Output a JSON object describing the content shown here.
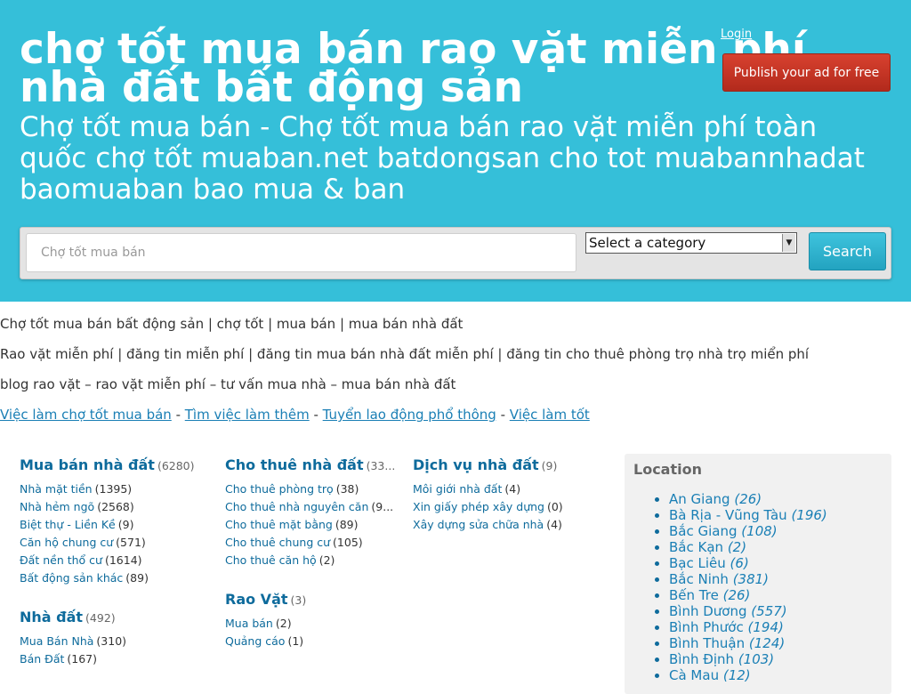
{
  "header": {
    "title": "chợ tốt mua bán rao vặt miễn phí nhà đất bất động sản",
    "description": "Chợ tốt mua bán - Chợ tốt mua bán rao vặt miễn phí toàn quốc chợ tốt muaban.net batdongsan cho tot muabannhadat baomuaban bao mua & ban",
    "login_label": "Login",
    "publish_label": "Publish your ad for free",
    "bg_color": "#35bfd9"
  },
  "search": {
    "placeholder": "Chợ tốt mua bán",
    "category_selected": "Select a category",
    "button_label": "Search"
  },
  "intro": {
    "line1": "Chợ tốt mua bán bất động sản | chợ tốt | mua bán | mua bán nhà đất",
    "line2": "Rao vặt miễn phí | đăng tin miễn phí | đăng tin mua bán nhà đất miễn phí | đăng tin cho thuê phòng trọ nhà trọ miển phí",
    "line3": "blog rao vặt – rao vặt miễn phí – tư vấn mua nhà – mua bán nhà đất",
    "links": [
      "Việc làm chợ tốt mua bán",
      "Tìm việc làm thêm",
      "Tuyển lao động phổ thông",
      "Việc làm tốt"
    ],
    "separator": " - "
  },
  "categories": {
    "mua_ban": {
      "title": "Mua bán nhà đất",
      "count": "(6280)",
      "items": [
        {
          "label": "Nhà mặt tiền",
          "count": "(1395)"
        },
        {
          "label": "Nhà hẻm ngõ",
          "count": "(2568)"
        },
        {
          "label": "Biệt thự - Liền Kề",
          "count": "(9)"
        },
        {
          "label": "Căn hộ chung cư",
          "count": "(571)"
        },
        {
          "label": "Đất nền thổ cư",
          "count": "(1614)"
        },
        {
          "label": "Bất động sản khác",
          "count": "(89)"
        }
      ]
    },
    "nha_dat": {
      "title": "Nhà đất",
      "count": "(492)",
      "items": [
        {
          "label": "Mua Bán Nhà",
          "count": "(310)"
        },
        {
          "label": "Bán Đất",
          "count": "(167)"
        }
      ]
    },
    "cho_thue": {
      "title": "Cho thuê nhà đất",
      "count": "(33...",
      "items": [
        {
          "label": "Cho thuê phòng trọ",
          "count": "(38)"
        },
        {
          "label": "Cho thuê nhà nguyên căn",
          "count": "(9..."
        },
        {
          "label": "Cho thuê mặt bằng",
          "count": "(89)"
        },
        {
          "label": "Cho thuê chung cư",
          "count": "(105)"
        },
        {
          "label": "Cho thuê căn hộ",
          "count": "(2)"
        }
      ]
    },
    "rao_vat": {
      "title": "Rao Vặt",
      "count": "(3)",
      "items": [
        {
          "label": "Mua bán",
          "count": "(2)"
        },
        {
          "label": "Quảng cáo",
          "count": "(1)"
        }
      ]
    },
    "dich_vu": {
      "title": "Dịch vụ nhà đất",
      "count": "(9)",
      "items": [
        {
          "label": "Môi giới nhà đất",
          "count": "(4)"
        },
        {
          "label": "Xin giấy phép xây dựng",
          "count": "(0)"
        },
        {
          "label": "Xây dựng sửa chữa nhà",
          "count": "(4)"
        }
      ]
    }
  },
  "location": {
    "title": "Location",
    "items": [
      {
        "label": "An Giang",
        "count": "(26)"
      },
      {
        "label": "Bà Rịa - Vũng Tàu",
        "count": "(196)"
      },
      {
        "label": "Bắc Giang",
        "count": "(108)"
      },
      {
        "label": "Bắc Kạn",
        "count": "(2)"
      },
      {
        "label": "Bạc Liêu",
        "count": "(6)"
      },
      {
        "label": "Bắc Ninh",
        "count": "(381)"
      },
      {
        "label": "Bến Tre",
        "count": "(26)"
      },
      {
        "label": "Bình Dương",
        "count": "(557)"
      },
      {
        "label": "Bình Phước",
        "count": "(194)"
      },
      {
        "label": "Bình Thuận",
        "count": "(124)"
      },
      {
        "label": "Bình Định",
        "count": "(103)"
      },
      {
        "label": "Cà Mau",
        "count": "(12)"
      }
    ]
  }
}
